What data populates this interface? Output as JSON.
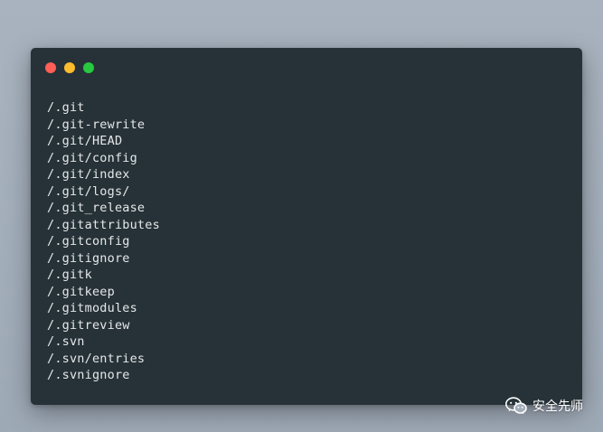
{
  "window": {
    "controls": [
      "close",
      "minimize",
      "maximize"
    ],
    "colors": {
      "background": "#263238",
      "close": "#ff5f56",
      "minimize": "#ffbd2e",
      "maximize": "#27c93f",
      "text": "#e6e8ea"
    }
  },
  "code": {
    "lines": [
      "/.git",
      "/.git-rewrite",
      "/.git/HEAD",
      "/.git/config",
      "/.git/index",
      "/.git/logs/",
      "/.git_release",
      "/.gitattributes",
      "/.gitconfig",
      "/.gitignore",
      "/.gitk",
      "/.gitkeep",
      "/.gitmodules",
      "/.gitreview",
      "/.svn",
      "/.svn/entries",
      "/.svnignore"
    ]
  },
  "watermark": {
    "icon": "wechat-icon",
    "text": "安全先师"
  }
}
